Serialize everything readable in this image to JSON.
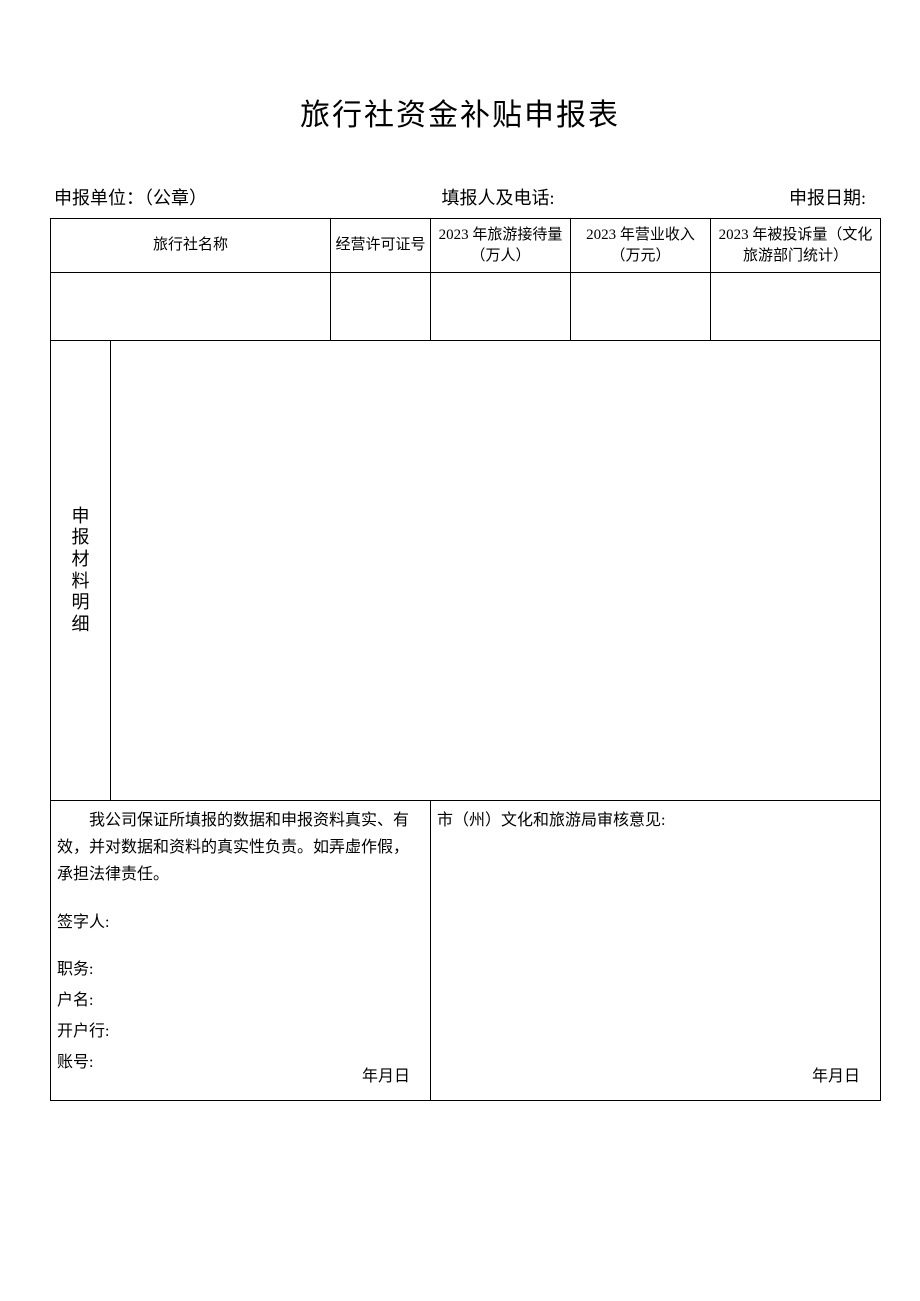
{
  "title": "旅行社资金补贴申报表",
  "header": {
    "unit_label": "申报单位：（公章）",
    "filler_label": "填报人及电话:",
    "date_label": "申报日期:"
  },
  "table": {
    "headers": {
      "agency_name": "旅行社名称",
      "license_no": "经营许可证号",
      "reception": "2023 年旅游接待量（万人）",
      "revenue": "2023 年营业收入（万元）",
      "complaints": "2023 年被投诉量（文化旅游部门统计）"
    },
    "row": {
      "agency_name": "",
      "license_no": "",
      "reception": "",
      "revenue": "",
      "complaints": ""
    },
    "materials_label": "申报材料明细",
    "materials_content": "",
    "declaration": {
      "text": "我公司保证所填报的数据和申报资料真实、有效，并对数据和资料的真实性负责。如弄虚作假，承担法律责任。",
      "signer_label": "签字人:",
      "position_label": "职务:",
      "account_name_label": "户名:",
      "bank_label": "开户行:",
      "account_no_label": "账号:",
      "date_text": "年月日"
    },
    "review": {
      "label": "市（州）文化和旅游局审核意见:",
      "date_text": "年月日"
    }
  }
}
